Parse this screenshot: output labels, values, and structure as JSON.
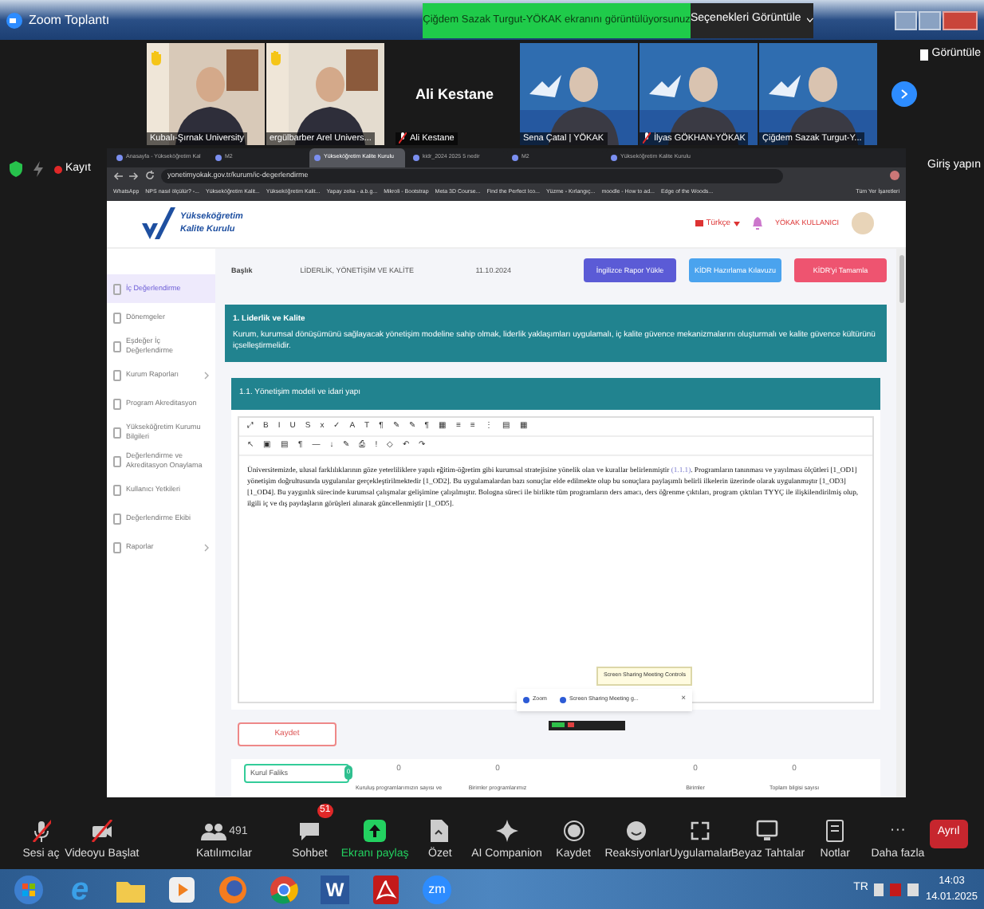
{
  "window": {
    "title": "Zoom Toplantı",
    "share_banner": "Çiğdem Sazak Turgut-YÖKAK ekranını görüntülüyorsunuz",
    "view_options": "Seçenekleri Görüntüle",
    "view_button": "Görüntüle"
  },
  "participants": [
    {
      "kind": "video",
      "name": "Kubalı-Şırnak University",
      "hand_raised": true,
      "muted": false
    },
    {
      "kind": "video",
      "name": "ergülbarber Arel Univers...",
      "hand_raised": true,
      "muted": false
    },
    {
      "kind": "name_only",
      "name": "Ali Kestane",
      "label": "Ali Kestane",
      "hand_raised": false,
      "muted": true
    },
    {
      "kind": "video",
      "name": "Sena Çatal | YÖKAK",
      "hand_raised": false,
      "muted": false
    },
    {
      "kind": "video",
      "name": "İlyas GÖKHAN-YÖKAK",
      "hand_raised": false,
      "muted": true
    },
    {
      "kind": "video",
      "name": "Çiğdem Sazak Turgut-Y...",
      "hand_raised": false,
      "muted": false
    }
  ],
  "recording": {
    "label": "Kayıt"
  },
  "sign_in": "Giriş yapın",
  "browser": {
    "tabs": [
      {
        "label": "Anasayfa - Yükseköğretim Kal",
        "selected": false
      },
      {
        "label": "M2",
        "selected": false
      },
      {
        "label": "Yükseköğretim Kalite Kurulu",
        "selected": true
      },
      {
        "label": "kidr_2024 2025 5 nedir",
        "selected": false
      },
      {
        "label": "M2",
        "selected": false
      },
      {
        "label": "Yükseköğretim Kalite Kurulu",
        "selected": false
      }
    ],
    "address": "yonetimyokak.gov.tr/kurum/ic-degerlendirme",
    "bookmarks": [
      "WhatsApp",
      "NPS nasıl ölçülür? -...",
      "Yükseköğretim Kalit...",
      "Yükseköğretim Kalit...",
      "Yapay zeka - a.b.g...",
      "Mikroli - Bootstrap",
      "Meta 3D Course...",
      "Find the Perfect Ico...",
      "Yüzme - Kırlangıç...",
      "moodle - How to ad...",
      "Edge of the Woods..."
    ],
    "all_bookmarks": "Tüm Yer İşaretleri"
  },
  "page": {
    "logo": {
      "line1": "Yükseköğretim",
      "line2": "Kalite Kurulu"
    },
    "language": "Türkçe",
    "user": "YÖKAK KULLANICI",
    "sidebar": [
      {
        "label": "İç Değerlendirme",
        "selected": true,
        "expandable": false
      },
      {
        "label": "Dönemgeler",
        "selected": false,
        "expandable": false
      },
      {
        "label": "Eşdeğer İç Değerlendirme",
        "selected": false,
        "expandable": false
      },
      {
        "label": "Kurum Raporları",
        "selected": false,
        "expandable": true
      },
      {
        "label": "Program Akreditasyon",
        "selected": false,
        "expandable": false
      },
      {
        "label": "Yükseköğretim Kurumu Bilgileri",
        "selected": false,
        "expandable": false
      },
      {
        "label": "Değerlendirme ve Akreditasyon Onaylama",
        "selected": false,
        "expandable": false
      },
      {
        "label": "Kullanıcı Yetkileri",
        "selected": false,
        "expandable": false
      },
      {
        "label": "Değerlendirme Ekibi",
        "selected": false,
        "expandable": false
      },
      {
        "label": "Raporlar",
        "selected": false,
        "expandable": true
      }
    ],
    "field_label": "Başlık",
    "field_value": "LİDERLİK, YÖNETİŞİM VE KALİTE",
    "date": "11.10.2024",
    "buttons": [
      {
        "label": "İngilizce Rapor Yükle",
        "color": "#5b5bd6"
      },
      {
        "label": "KİDR Hazırlama Kılavuzu",
        "color": "#4aa3ee"
      },
      {
        "label": "KİDR'yi Tamamla",
        "color": "#ee5470"
      }
    ],
    "section": {
      "title": "1. Liderlik ve Kalite",
      "description": "Kurum, kurumsal dönüşümünü sağlayacak yönetişim modeline sahip olmak, liderlik yaklaşımları uygulamalı, iç kalite güvence mekanizmalarını oluşturmalı ve kalite güvence kültürünü içselleştirmelidir."
    },
    "subsection": {
      "title": "1.1. Yönetişim modeli ve idari yapı"
    },
    "editor": {
      "toolbar_row1": [
        "⤢",
        "B",
        "I",
        "U",
        "S",
        "x",
        "✓",
        "A",
        "T",
        "¶",
        "✎",
        "✎",
        "¶",
        "▦",
        "≡",
        "≡",
        "⋮",
        "▤",
        "▦"
      ],
      "toolbar_row2": [
        "↖",
        "▣",
        "▤",
        "¶",
        "—",
        "↓",
        "✎",
        "⎙",
        "!",
        "◇",
        "↶",
        "↷"
      ],
      "text_before": "Üniversitemizde, ulusal farklılıklarının göze yeterliliklere yapılı eğitim-öğretim gibi kurumsal stratejisine yönelik olan ve kurallar belirlenmiştir",
      "link": "(1.1.1)",
      "text_after": ". Programların tanınması ve yayılması ölçütleri [1_OD1] yönetişim doğrultusunda uygulanılar gerçekleştirilmektedir [1_OD2]. Bu uygulamalardan bazı sonuçlar elde edilmekte olup bu sonuçlara paylaşımlı belirli ilkelerin üzerinde olarak uygulanmıştır [1_OD3][1_OD4]. Bu yaygınlık sürecinde kurumsal çalışmalar gelişimine çalışılmıştır. Bologna süreci ile birlikte tüm programların ders amacı, ders öğrenme çıktıları, program çıktıları TYYÇ ile ilişkilendirilmiş olup, ilgili iç ve dış paydaşların görüşleri alınarak güncellenmiştir [1_OD5]."
    },
    "save_button": "Kaydet",
    "stats": [
      {
        "kind": "field",
        "label": "Kurul Faliks",
        "badge": "0"
      },
      {
        "kind": "count",
        "value": "0",
        "caption": "Kuruluş programlarımızın sayısı ve"
      },
      {
        "kind": "count",
        "value": "0",
        "caption": "Birimler programlarımız"
      },
      {
        "kind": "gap"
      },
      {
        "kind": "count",
        "value": "0",
        "caption": "Birimler"
      },
      {
        "kind": "count",
        "value": "0",
        "caption": "Toplam bilgisi sayısı"
      }
    ]
  },
  "share_popup": {
    "tooltip": "Screen Sharing Meeting Controls",
    "items": [
      "Zoom",
      "Screen Sharing Meeting g..."
    ],
    "close": "×"
  },
  "toolbar": [
    {
      "kind": "mic",
      "label": "Sesi aç",
      "off": true
    },
    {
      "kind": "video",
      "label": "Videoyu Başlat",
      "off": true
    },
    {
      "kind": "people",
      "label": "Katılımcılar",
      "count": "491"
    },
    {
      "kind": "chat",
      "label": "Sohbet",
      "badge": "51"
    },
    {
      "kind": "share",
      "label": "Ekranı paylaş"
    },
    {
      "kind": "doc",
      "label": "Özet"
    },
    {
      "kind": "sparkle",
      "label": "AI Companion"
    },
    {
      "kind": "record",
      "label": "Kaydet"
    },
    {
      "kind": "smile",
      "label": "Reaksiyonlar"
    },
    {
      "kind": "apps",
      "label": "Uygulamalar"
    },
    {
      "kind": "board",
      "label": "Beyaz Tahtalar"
    },
    {
      "kind": "notes",
      "label": "Notlar"
    },
    {
      "kind": "more",
      "label": "Daha fazla",
      "glyph": "···"
    }
  ],
  "leave_button": "Ayrıl",
  "taskbar": {
    "apps": [
      {
        "kind": "start"
      },
      {
        "kind": "ie",
        "glyph": "e"
      },
      {
        "kind": "folder"
      },
      {
        "kind": "media"
      },
      {
        "kind": "firefox"
      },
      {
        "kind": "chrome"
      },
      {
        "kind": "word",
        "glyph": "W"
      },
      {
        "kind": "pdf"
      },
      {
        "kind": "zoom",
        "glyph": "zm"
      }
    ],
    "language": "TR",
    "time": "14:03",
    "date": "14.01.2025"
  }
}
